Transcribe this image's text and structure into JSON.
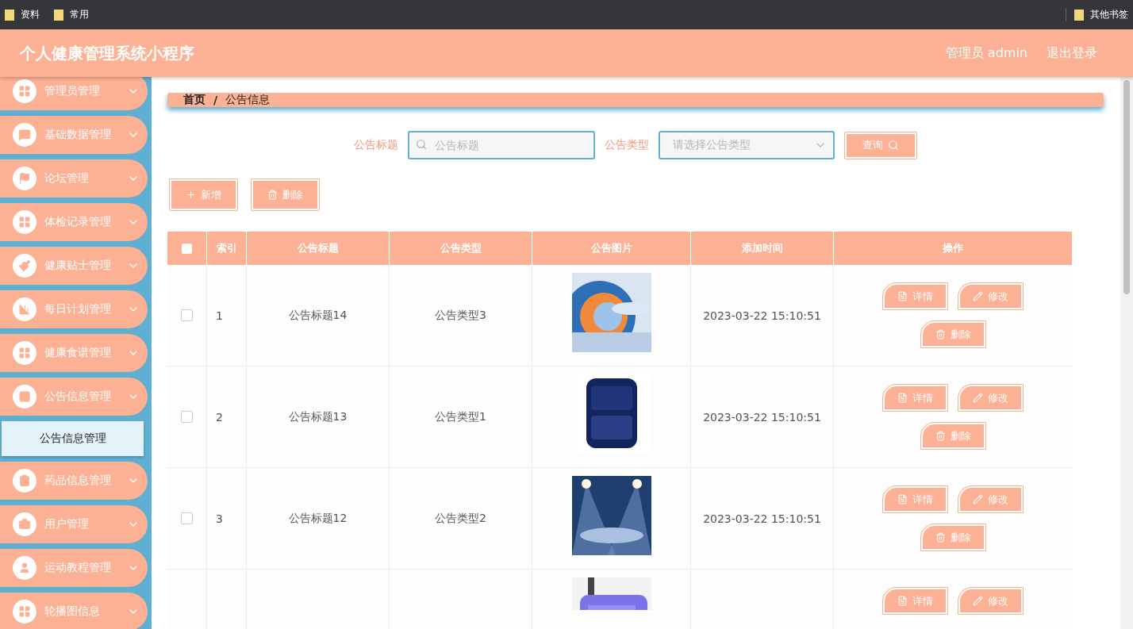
{
  "bookmarks": {
    "left": [
      "资料",
      "常用"
    ],
    "right": [
      "其他书签"
    ]
  },
  "header": {
    "title": "个人健康管理系统小程序",
    "user": "管理员 admin",
    "logout": "退出登录"
  },
  "sidebar": {
    "items": [
      {
        "label": "管理员管理"
      },
      {
        "label": "基础数据管理"
      },
      {
        "label": "论坛管理"
      },
      {
        "label": "体检记录管理"
      },
      {
        "label": "健康贴士管理"
      },
      {
        "label": "每日计划管理"
      },
      {
        "label": "健康食谱管理"
      },
      {
        "label": "公告信息管理",
        "children": [
          {
            "label": "公告信息管理"
          }
        ]
      },
      {
        "label": "药品信息管理"
      },
      {
        "label": "用户管理"
      },
      {
        "label": "运动教程管理"
      },
      {
        "label": "轮播图信息"
      }
    ]
  },
  "breadcrumb": {
    "home": "首页",
    "separator": "/",
    "current": "公告信息"
  },
  "search": {
    "title_label": "公告标题",
    "title_placeholder": "公告标题",
    "type_label": "公告类型",
    "type_placeholder": "请选择公告类型",
    "button": "查询"
  },
  "toolbar": [
    {
      "label": "新增",
      "kind": "add"
    },
    {
      "label": "删除",
      "kind": "delete"
    }
  ],
  "table": {
    "select_all_checked": false,
    "columns": [
      "索引",
      "公告标题",
      "公告类型",
      "公告图片",
      "添加时间",
      "操作"
    ],
    "rows": [
      {
        "checked": false,
        "index": "1",
        "title": "公告标题14",
        "type": "公告类型3",
        "picture": {
          "kind": "picture"
        },
        "time": "2023-03-22 15:10:51",
        "actions": [
          {
            "label": "详情",
            "kind": "detail"
          },
          {
            "label": "修改",
            "kind": "edit"
          },
          {
            "label": "删除",
            "kind": "delete"
          }
        ]
      },
      {
        "checked": false,
        "index": "2",
        "title": "公告标题13",
        "type": "公告类型1",
        "picture": {
          "kind": "picture"
        },
        "time": "2023-03-22 15:10:51",
        "actions": [
          {
            "label": "详情",
            "kind": "detail"
          },
          {
            "label": "修改",
            "kind": "edit"
          },
          {
            "label": "删除",
            "kind": "delete"
          }
        ]
      },
      {
        "checked": false,
        "index": "3",
        "title": "公告标题12",
        "type": "公告类型2",
        "picture": {
          "kind": "picture"
        },
        "time": "2023-03-22 15:10:51",
        "actions": [
          {
            "label": "详情",
            "kind": "detail"
          },
          {
            "label": "修改",
            "kind": "edit"
          },
          {
            "label": "删除",
            "kind": "delete"
          }
        ]
      },
      {
        "picture": {
          "kind": "picture"
        },
        "actions": [
          {
            "label": "详情",
            "kind": "detail"
          },
          {
            "label": "修改",
            "kind": "edit"
          }
        ]
      }
    ]
  }
}
